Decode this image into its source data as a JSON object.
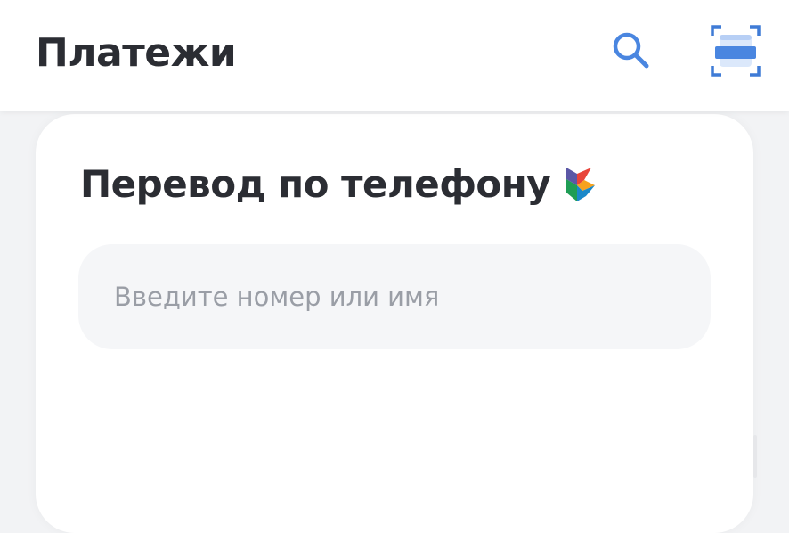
{
  "header": {
    "title": "Платежи",
    "search_icon": "search-icon",
    "scan_icon": "scan-qr-icon"
  },
  "card": {
    "title": "Перевод по телефону",
    "logo_icon": "sbp-logo-icon",
    "input": {
      "value": "",
      "placeholder": "Введите номер или имя"
    }
  },
  "colors": {
    "accent": "#4a86e0",
    "text": "#2b2d33",
    "placeholder": "#9a9ea6",
    "input_bg": "#f5f6f8",
    "page_bg": "#f2f3f5"
  }
}
